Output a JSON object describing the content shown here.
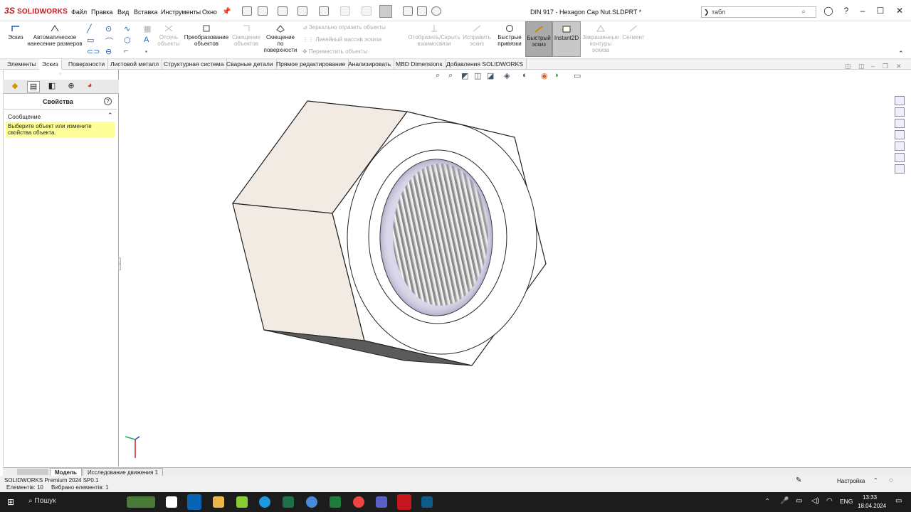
{
  "app": {
    "logo": "SOLIDWORKS",
    "menus": [
      "Файл",
      "Правка",
      "Вид",
      "Вставка",
      "Инструменты",
      "Окно"
    ],
    "document_title": "DIN 917 - Hexagon Cap Nut.SLDPRT *",
    "search": {
      "prefix": "❯",
      "value": "табл"
    }
  },
  "command_manager": {
    "sketch": "Эскиз",
    "auto_dim": "Автоматическое нанесение размеров",
    "trim": "Отсечь объекты",
    "convert": "Преобразование объектов",
    "offset": "Смещение объектов",
    "offset_surface": "Смещение по поверхности",
    "mirror": "Зеркально отразить объекты",
    "linear_pattern": "Линейный массив эскиза",
    "move": "Переместить объекты",
    "show_hide": "Отобразить/Скрыть взаимосвязи",
    "repair": "Исправить эскиз",
    "quick_snaps": "Быстрые привязки",
    "rapid_sketch": "Быстрый эскиз",
    "instant2d": "Instant2D",
    "shaded": "Закрашенные контуры эскиза",
    "segment": "Сегмент"
  },
  "tabs": [
    "Элементы",
    "Эскиз",
    "Поверхности",
    "Листовой металл",
    "Структурная система",
    "Сварные детали",
    "Прямое редактирование",
    "Анализировать",
    "MBD Dimensions",
    "Добавления SOLIDWORKS"
  ],
  "active_tab": "Эскиз",
  "property_manager": {
    "title": "Свойства",
    "message_header": "Сообщение",
    "message": "Выберите объект или измените свойства объекта."
  },
  "bottom_tabs": [
    "Модель",
    "Исследование движения 1"
  ],
  "status": {
    "product": "SOLIDWORKS Premium 2024 SP0.1",
    "elements": "Елементів: 10",
    "selected": "Вибрано елементів: 1",
    "settings": "Настройка"
  },
  "taskbar": {
    "search": "Пошук",
    "lang": "ENG",
    "time": "13:33",
    "date": "18.04.2024"
  },
  "colors": {
    "accent": "#c4161c",
    "message_bg": "#ffff99",
    "nut_face": "#f2ebe3"
  }
}
